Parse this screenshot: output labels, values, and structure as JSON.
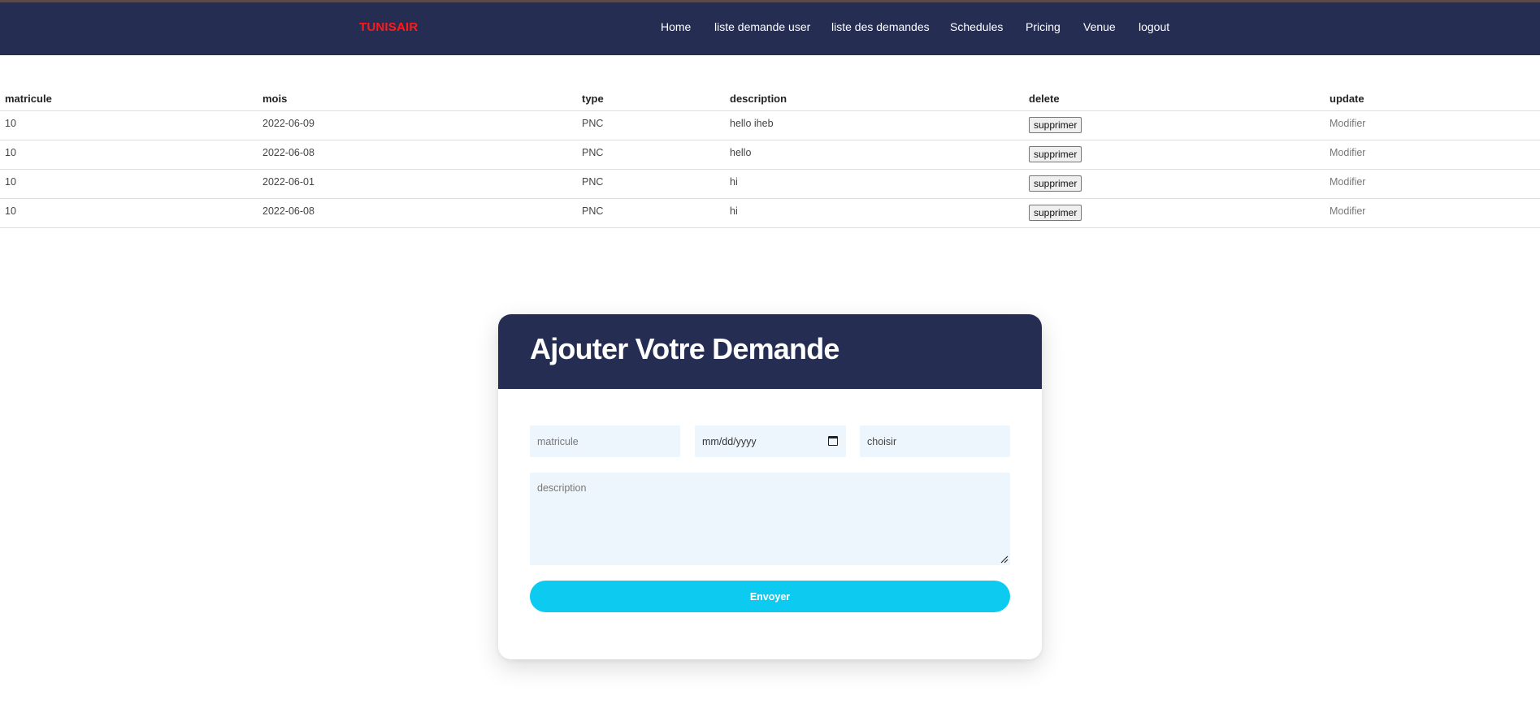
{
  "navbar": {
    "brand": "TUNISAIR",
    "links": [
      {
        "label": "Home"
      },
      {
        "label": "liste demande user"
      },
      {
        "label": "liste des demandes"
      },
      {
        "label": "Schedules"
      },
      {
        "label": "Pricing"
      },
      {
        "label": "Venue"
      },
      {
        "label": "logout"
      }
    ]
  },
  "table": {
    "headers": [
      "matricule",
      "mois",
      "type",
      "description",
      "delete",
      "update"
    ],
    "rows": [
      {
        "matricule": "10",
        "mois": "2022-06-09",
        "type": "PNC",
        "description": "hello iheb",
        "delete": "supprimer",
        "update": "Modifier"
      },
      {
        "matricule": "10",
        "mois": "2022-06-08",
        "type": "PNC",
        "description": "hello",
        "delete": "supprimer",
        "update": "Modifier"
      },
      {
        "matricule": "10",
        "mois": "2022-06-01",
        "type": "PNC",
        "description": "hi",
        "delete": "supprimer",
        "update": "Modifier"
      },
      {
        "matricule": "10",
        "mois": "2022-06-08",
        "type": "PNC",
        "description": "hi",
        "delete": "supprimer",
        "update": "Modifier"
      }
    ]
  },
  "form": {
    "title": "Ajouter Votre Demande",
    "matricule_placeholder": "matricule",
    "date_placeholder": "mm/dd/yyyy",
    "type_value": "choisir",
    "description_placeholder": "description",
    "submit_label": "Envoyer"
  },
  "colors": {
    "navbar_bg": "#262d53",
    "brand": "#ff1a1a",
    "input_bg": "#eef6fd",
    "submit_bg": "#0dcaf0"
  },
  "icons": {
    "date_picker": "calendar-icon",
    "textarea_resize": "resize-handle-icon"
  }
}
